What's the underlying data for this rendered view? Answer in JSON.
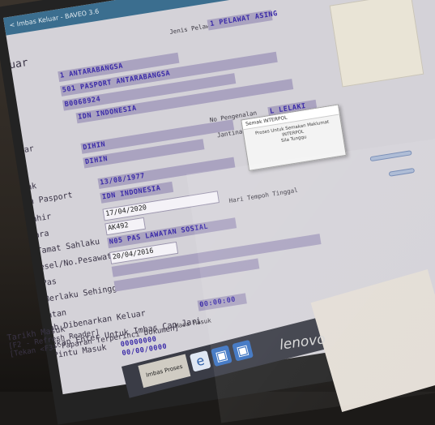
{
  "window": {
    "title": "< Imbas Keluar - BAVEO 3.6"
  },
  "header": {
    "jenis_label": "Jenis Pelawat",
    "jenis_value": "1  PELAWAT ASING"
  },
  "left_labels": {
    "title_fragment": "uar",
    "uar2": "uar",
    "ak": "ak",
    "n_pasport": "n Pasport",
    "ahir": "ahir",
    "ara": "ara",
    "tamat": "Tamat Sahlaku",
    "kesel": "esel/No.Pesawat",
    "pas": "Pas",
    "berlaku": "Berlaku Sehingga",
    "atan": "atan",
    "dibenarkan": "ab Dibenarkan Keluar",
    "tekan_enter": "ekan Enter Untuk Imbas Cap Jari",
    "pintu": "Pintu Masuk",
    "tarikh": "Tarikh Masuk",
    "f2": "[F2 - Refresh Reader]",
    "f3": "[Tekan <F3>-Paparan Terperinci Dokumen]"
  },
  "fields": {
    "dokumen": "1  ANTARABANGSA",
    "jenis_pasport": "501  PASPORT ANTARABANGSA",
    "no_dokumen": "B0068924",
    "negara": "IDN  INDONESIA",
    "nama1": "DIHIN",
    "nama2": "DIHIN",
    "tarikh_lahir": "13/08/1977",
    "warganegara": "IDN  INDONESIA",
    "tamat_tarikh": "17/04/2020",
    "kapal": "AK492",
    "pas_code": "N05  PAS LAWATAN SOSIAL",
    "berlaku_tarikh": "20/04/2016",
    "time_field": "00:00:00",
    "masa_value": "00000000",
    "tarikh_masuk": "00/00/0000"
  },
  "right_labels": {
    "no_pengenalan": "No Pengenalan",
    "jantina": "Jantina",
    "jantina_value": "L  LELAKI",
    "hari_tempoh": "Hari Tempoh Tinggal",
    "masa_masuk": "Masa Masuk"
  },
  "popup": {
    "title": "Semak INTERPOL",
    "line1": "Proses Untuk Semakan Maklumat",
    "line2": "INTERPOL",
    "line3": "Sila Tunggu"
  },
  "taskbar": {
    "start_label": "Imbas Proses"
  },
  "bezel": {
    "brand": "lenovo"
  }
}
